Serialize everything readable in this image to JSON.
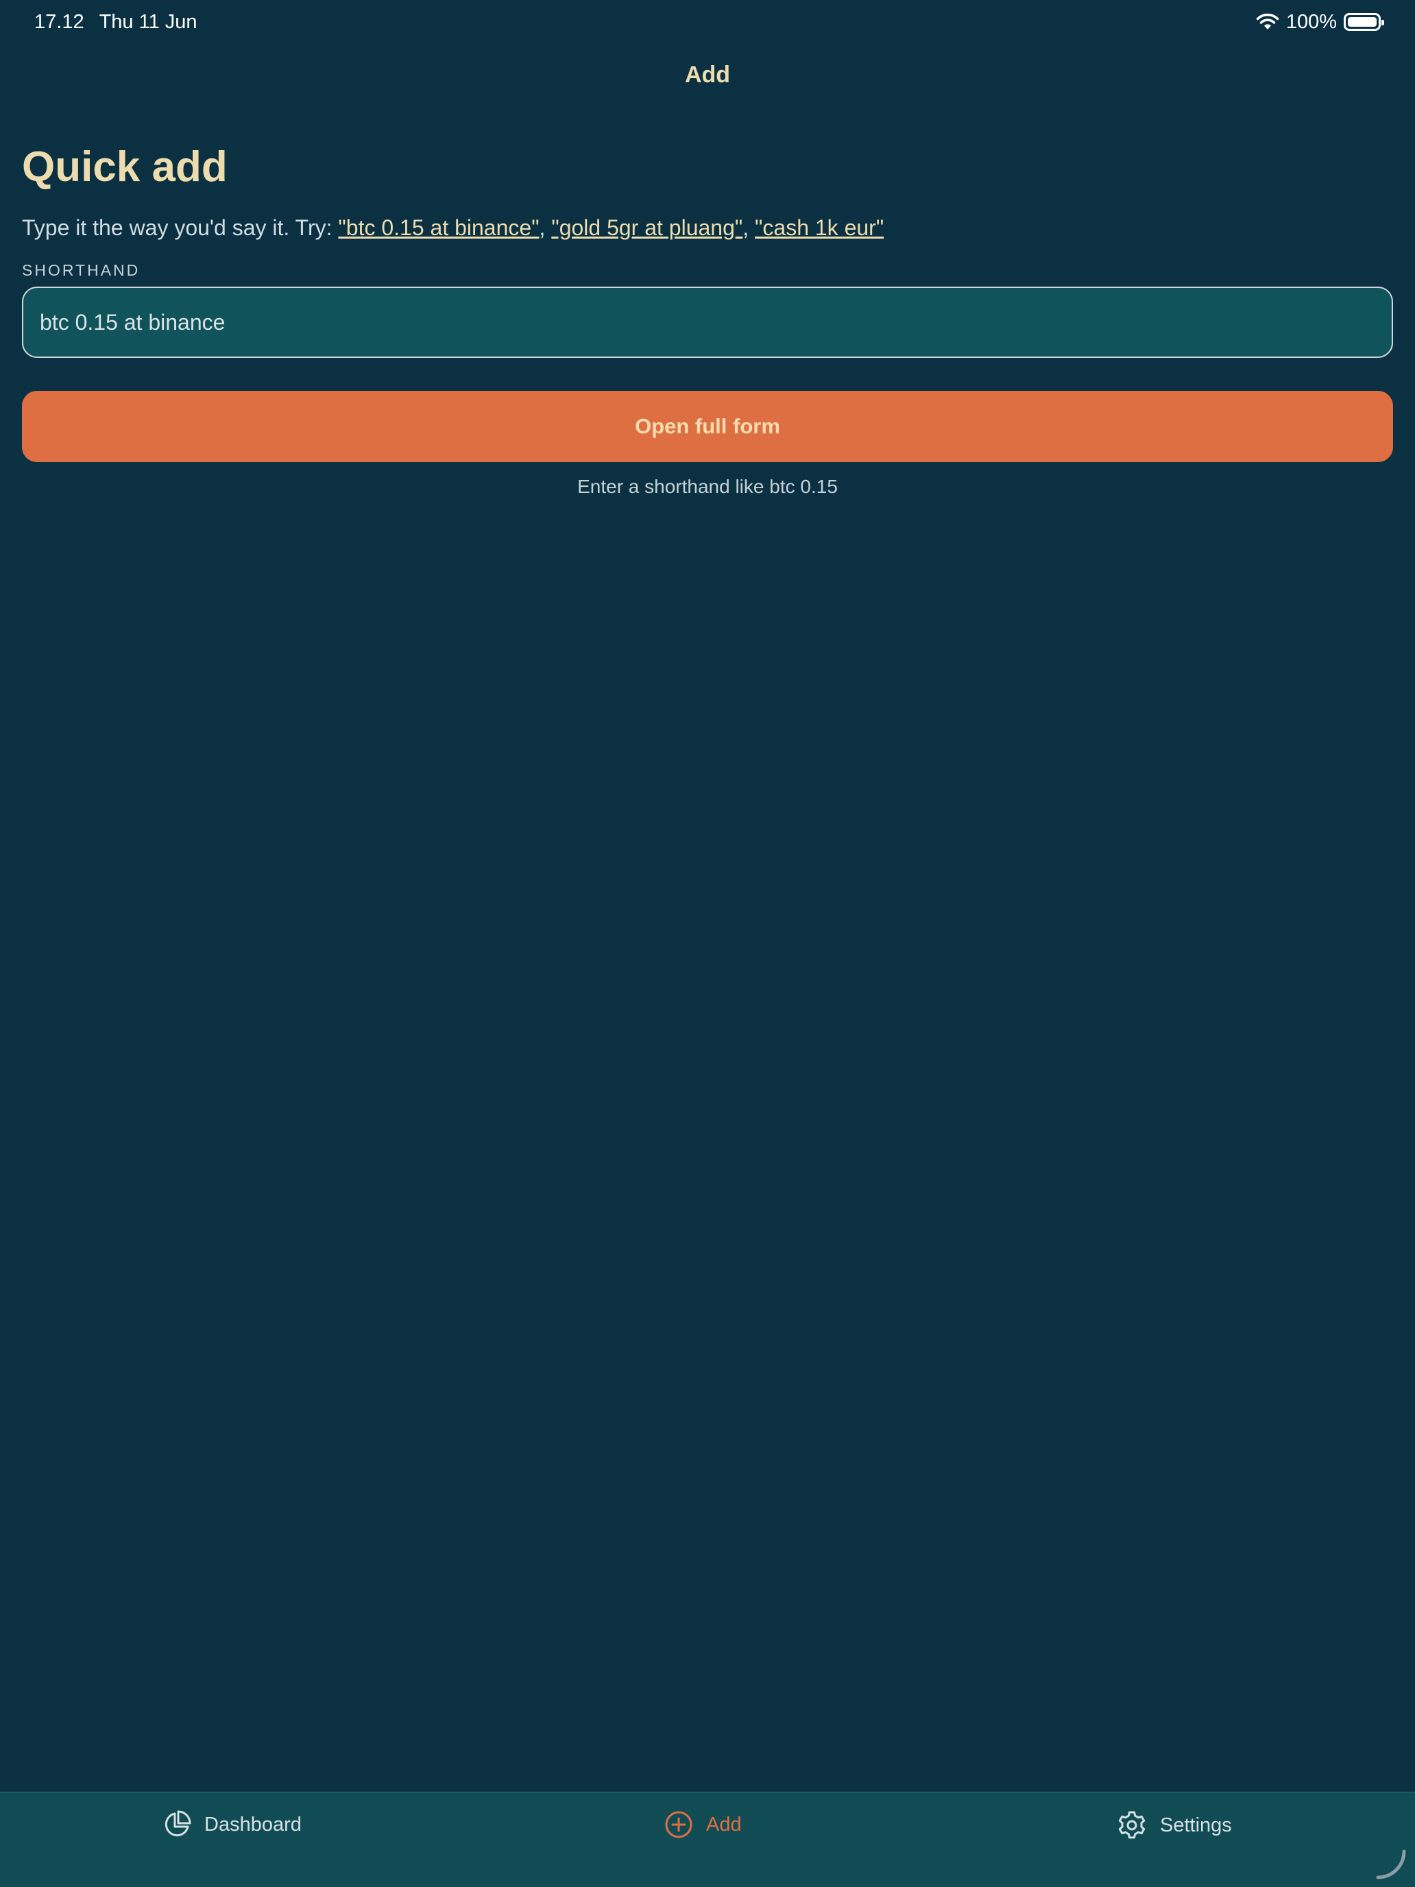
{
  "status_bar": {
    "time": "17.12",
    "date": "Thu 11 Jun",
    "battery_text": "100%"
  },
  "nav": {
    "title": "Add"
  },
  "quick_add": {
    "heading": "Quick add",
    "hint_prefix": "Type it the way you'd say it. Try: ",
    "examples": [
      "\"btc 0.15 at binance\"",
      "\"gold 5gr at pluang\"",
      "\"cash 1k eur\""
    ],
    "separator": ", ",
    "field_label": "SHORTHAND",
    "input_value": "btc 0.15 at binance",
    "button_label": "Open full form",
    "helper_text": "Enter a shorthand like btc 0.15"
  },
  "tabs": [
    {
      "label": "Dashboard",
      "icon": "pie-chart-icon",
      "active": false
    },
    {
      "label": "Add",
      "icon": "plus-circle-icon",
      "active": true
    },
    {
      "label": "Settings",
      "icon": "gear-icon",
      "active": false
    }
  ],
  "colors": {
    "background": "#0b3042",
    "accent": "#de6f43",
    "heading": "#ecdcae",
    "input_bg": "#11535a",
    "tab_bar_bg": "#114c55"
  }
}
